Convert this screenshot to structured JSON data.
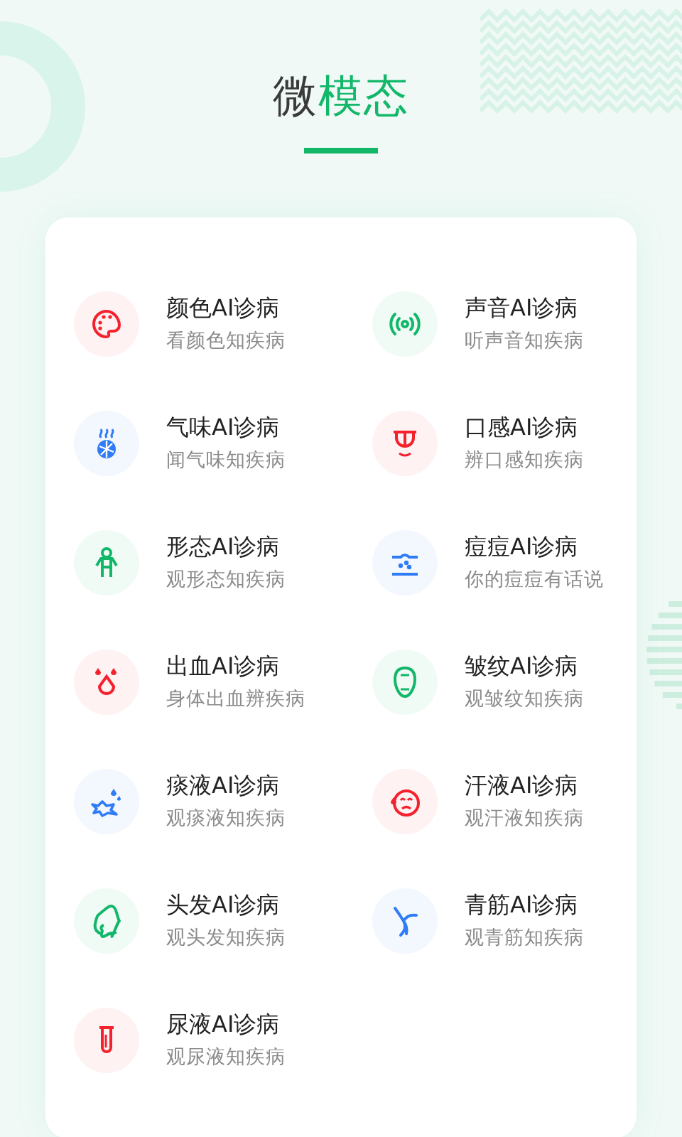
{
  "header": {
    "title_parts": [
      {
        "text": "微",
        "accent": false
      },
      {
        "text": "模态",
        "accent": true
      }
    ]
  },
  "items": [
    {
      "kind": "palette",
      "color": "#f5222d",
      "title": "颜色AI诊病",
      "subtitle": "看颜色知疾病"
    },
    {
      "kind": "signal",
      "color": "#12b76a",
      "title": "声音AI诊病",
      "subtitle": "听声音知疾病"
    },
    {
      "kind": "smell",
      "color": "#2f7cf6",
      "title": "气味AI诊病",
      "subtitle": "闻气味知疾病"
    },
    {
      "kind": "tongue",
      "color": "#f5222d",
      "title": "口感AI诊病",
      "subtitle": "辨口感知疾病"
    },
    {
      "kind": "person",
      "color": "#12b76a",
      "title": "形态AI诊病",
      "subtitle": "观形态知疾病"
    },
    {
      "kind": "acne",
      "color": "#2f7cf6",
      "title": "痘痘AI诊病",
      "subtitle": "你的痘痘有话说"
    },
    {
      "kind": "drops",
      "color": "#f5222d",
      "title": "出血AI诊病",
      "subtitle": "身体出血辨疾病"
    },
    {
      "kind": "face",
      "color": "#12b76a",
      "title": "皱纹AI诊病",
      "subtitle": "观皱纹知疾病"
    },
    {
      "kind": "splash",
      "color": "#2f7cf6",
      "title": "痰液AI诊病",
      "subtitle": "观痰液知疾病"
    },
    {
      "kind": "sweat",
      "color": "#f5222d",
      "title": "汗液AI诊病",
      "subtitle": "观汗液知疾病"
    },
    {
      "kind": "hair",
      "color": "#12b76a",
      "title": "头发AI诊病",
      "subtitle": "观头发知疾病"
    },
    {
      "kind": "vein",
      "color": "#2f7cf6",
      "title": "青筋AI诊病",
      "subtitle": "观青筋知疾病"
    },
    {
      "kind": "tube",
      "color": "#f5222d",
      "title": "尿液AI诊病",
      "subtitle": "观尿液知疾病"
    }
  ]
}
